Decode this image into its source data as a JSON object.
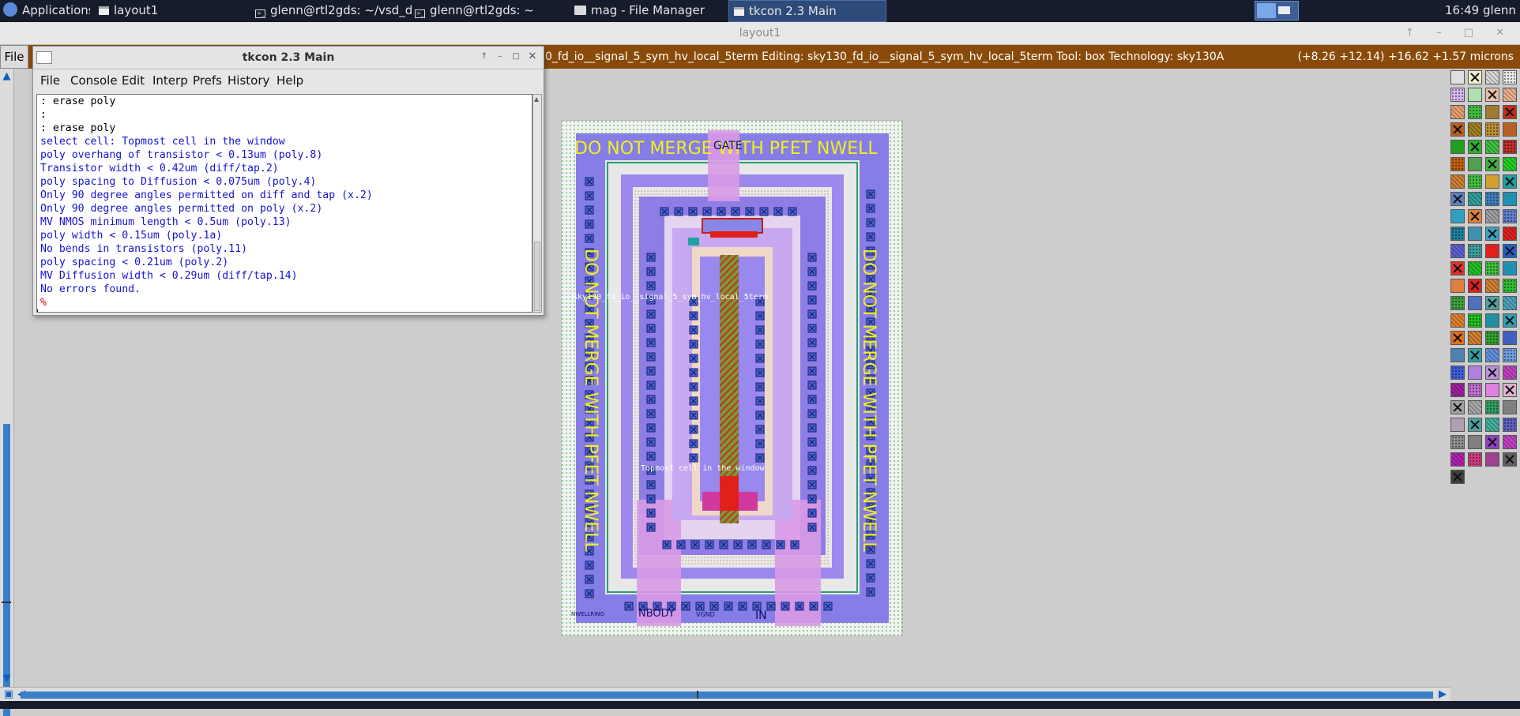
{
  "taskbar": {
    "apps_label": "Applications",
    "windows": [
      {
        "label": "layout1"
      },
      {
        "label": "glenn@rtl2gds: ~/vsd_d..."
      },
      {
        "label": "glenn@rtl2gds: ~"
      },
      {
        "label": "mag - File Manager"
      },
      {
        "label": "tkcon 2.3 Main",
        "active": true
      }
    ],
    "clock": "16:49",
    "user": "glenn"
  },
  "magic": {
    "window_title": "layout1",
    "file_menu": "File",
    "status": "0_fd_io__signal_5_sym_hv_local_5term Editing: sky130_fd_io__signal_5_sym_hv_local_5term Tool: box  Technology: sky130A",
    "coords": "(+8.26 +12.14) +16.62 +1.57 microns"
  },
  "tkcon": {
    "title": "tkcon 2.3 Main",
    "menu": [
      "File",
      "Console",
      "Edit",
      "Interp",
      "Prefs",
      "History",
      "Help"
    ],
    "lines": [
      {
        "text": ": erase poly",
        "kind": "cmd"
      },
      {
        "text": ":",
        "kind": "cmd"
      },
      {
        "text": ": erase poly",
        "kind": "cmd"
      },
      {
        "text": "select cell: Topmost cell in the window",
        "kind": "out"
      },
      {
        "text": "poly overhang of transistor < 0.13um (poly.8)",
        "kind": "out"
      },
      {
        "text": "Transistor width < 0.42um (diff/tap.2)",
        "kind": "out"
      },
      {
        "text": "poly spacing to Diffusion < 0.075um (poly.4)",
        "kind": "out"
      },
      {
        "text": "Only 90 degree angles permitted on diff and tap (x.2)",
        "kind": "out"
      },
      {
        "text": "Only 90 degree angles permitted on poly (x.2)",
        "kind": "out"
      },
      {
        "text": "MV NMOS minimum length < 0.5um (poly.13)",
        "kind": "out"
      },
      {
        "text": "poly width < 0.15um (poly.1a)",
        "kind": "out"
      },
      {
        "text": "No bends in transistors (poly.11)",
        "kind": "out"
      },
      {
        "text": "poly spacing < 0.21um (poly.2)",
        "kind": "out"
      },
      {
        "text": "MV Diffusion width < 0.29um (diff/tap.14)",
        "kind": "out"
      },
      {
        "text": "No errors found.",
        "kind": "out"
      }
    ],
    "prompt": "%"
  },
  "layout": {
    "banner_top": "DO NOT MERGE WITH PFET NWELL",
    "banner_left": "DO NOT MERGE WITH PFET NWELL",
    "banner_right": "DO NOT MERGE WITH PFET NWELL",
    "gate_label": "GATE",
    "cell_label": "sky130_fd_io__signal_5_sym_hv_local_5term",
    "topmost_label": "Topmost cell in the window",
    "nbody_label": "NBODY",
    "vgnd_label": "VGND",
    "in_label": "IN",
    "nwell_label": "NWELLRING"
  },
  "palette": {
    "colors": [
      [
        "#e0e0e0",
        "#f0ecd0",
        "#d8d8d8",
        "#e8e8e8"
      ],
      [
        "#d9b8f0",
        "#b0e0b0",
        "#e8c0a8",
        "#e8b090"
      ],
      [
        "#e8a070",
        "#40c040",
        "#a07a30",
        "#c03018"
      ],
      [
        "#b86020",
        "#a08020",
        "#c09030",
        "#b86020"
      ],
      [
        "#20a020",
        "#30b030",
        "#40c040",
        "#c03030"
      ],
      [
        "#c06010",
        "#50a050",
        "#40b040",
        "#20d020"
      ],
      [
        "#d08030",
        "#40c040",
        "#d0a030",
        "#20a0a0"
      ],
      [
        "#6080c0",
        "#30a0a0",
        "#4080c0",
        "#2090b0"
      ],
      [
        "#30a0c0",
        "#e08040",
        "#a0a0a0",
        "#6080d0"
      ],
      [
        "#2080a0",
        "#4090b0",
        "#40a0c0",
        "#e02020"
      ],
      [
        "#6060d0",
        "#40a0a0",
        "#e02020",
        "#2060c0"
      ],
      [
        "#e03030",
        "#20c020",
        "#40c040",
        "#2090b0"
      ],
      [
        "#e08040",
        "#e02020",
        "#d08030",
        "#30c030"
      ],
      [
        "#40a040",
        "#5070c0",
        "#50a0a0",
        "#50a0c0"
      ],
      [
        "#e08030",
        "#20c020",
        "#2090a0",
        "#30a0b0"
      ],
      [
        "#e07020",
        "#d08030",
        "#30a030",
        "#4060c0"
      ],
      [
        "#5080b0",
        "#30a0a0",
        "#6090e0",
        "#70a0e0"
      ],
      [
        "#4060e0",
        "#b080e0",
        "#c090e0",
        "#c040c0"
      ],
      [
        "#a020a0",
        "#c070d0",
        "#e080e0",
        "#e0b0d0"
      ],
      [
        "#a0a0a0",
        "#a8a8a8",
        "#30a060",
        "#808080"
      ],
      [
        "#b0a0b0",
        "#50a0a0",
        "#40b0a0",
        "#6060c0"
      ],
      [
        "#909090",
        "#808080",
        "#9040c0",
        "#c040c0"
      ],
      [
        "#b020b0",
        "#d04080",
        "#a04090",
        "#606060"
      ],
      [
        "#404040"
      ]
    ]
  }
}
